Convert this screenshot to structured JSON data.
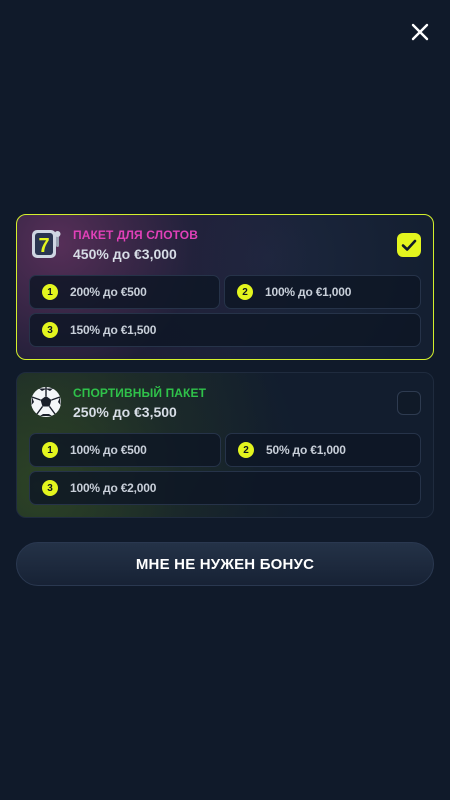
{
  "close": {
    "icon": "close-icon"
  },
  "packages": [
    {
      "icon": "slot-seven-icon",
      "title": "ПАКЕТ ДЛЯ СЛОТОВ",
      "subtitle": "450% до €3,000",
      "selected": true,
      "tiers": [
        {
          "num": "1",
          "text": "200% до €500"
        },
        {
          "num": "2",
          "text": "100% до €1,000"
        },
        {
          "num": "3",
          "text": "150% до €1,500"
        }
      ]
    },
    {
      "icon": "soccer-ball-icon",
      "title": "СПОРТИВНЫЙ ПАКЕТ",
      "subtitle": "250% до €3,500",
      "selected": false,
      "tiers": [
        {
          "num": "1",
          "text": "100% до €500"
        },
        {
          "num": "2",
          "text": "50% до €1,000"
        },
        {
          "num": "3",
          "text": "100% до €2,000"
        }
      ]
    }
  ],
  "no_bonus_label": "МНЕ НЕ НУЖЕН БОНУС",
  "colors": {
    "accent": "#e3f51e",
    "slots_title": "#e040b8",
    "sport_title": "#2fc24a",
    "background": "#101a2a"
  }
}
